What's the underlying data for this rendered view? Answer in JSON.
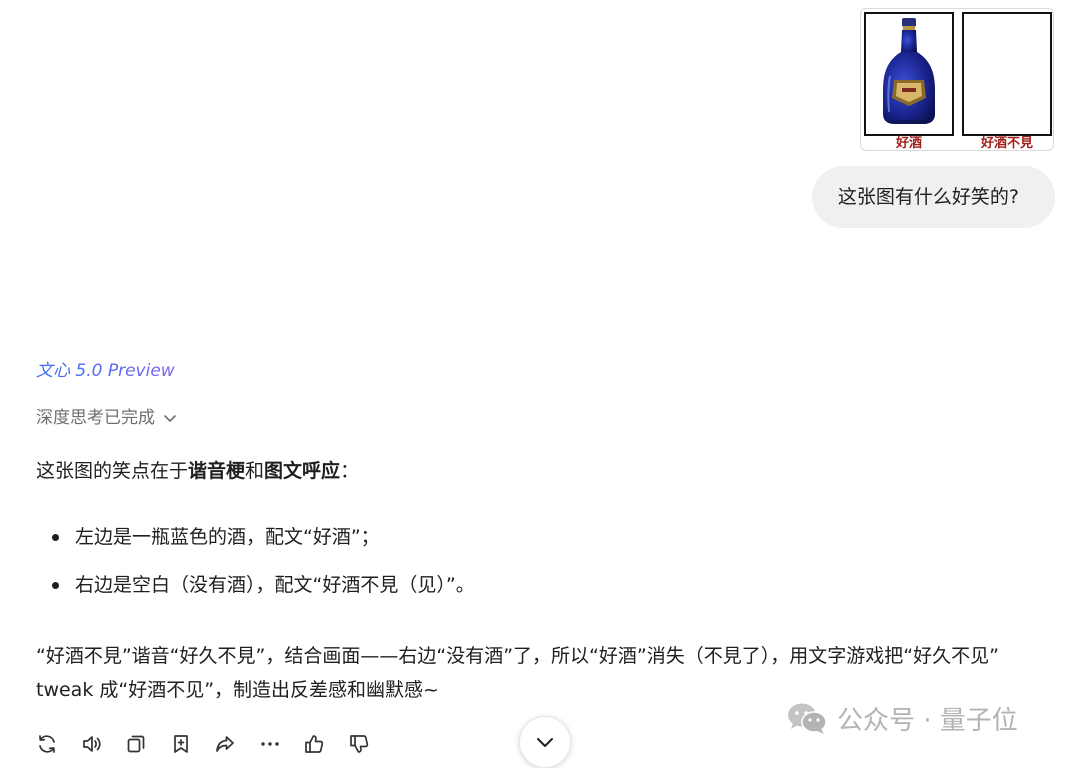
{
  "user_message": {
    "image": {
      "left_caption": "好酒",
      "right_caption": "好酒不見"
    },
    "text": "这张图有什么好笑的?"
  },
  "assistant": {
    "model_name": "文心 5.0 Preview",
    "thinking_status": "深度思考已完成",
    "intro": {
      "prefix": "这张图的笑点在于",
      "bold1": "谐音梗",
      "joiner": "和",
      "bold2": "图文呼应",
      "suffix": "："
    },
    "bullets": [
      "左边是一瓶蓝色的酒，配文“好酒”；",
      "右边是空白（没有酒），配文“好酒不見（见）”。"
    ],
    "paragraph": "“好酒不見”谐音“好久不見”，结合画面——右边“没有酒”了，所以“好酒”消失（不見了），用文字游戏把“好久不见” tweak 成“好酒不见”，制造出反差感和幽默感~"
  },
  "toolbar": {
    "icons": [
      "regenerate-icon",
      "speaker-icon",
      "copy-icon",
      "bookmark-add-icon",
      "share-icon",
      "more-icon",
      "thumbs-up-icon",
      "thumbs-down-icon"
    ]
  },
  "watermark": {
    "text": "公众号 · 量子位"
  },
  "colors": {
    "model_name_start": "#3a6cf0",
    "model_name_end": "#7b63f2",
    "caption_red": "#a0201c",
    "bubble_bg": "#f0f0f0",
    "muted_text": "#6f6f6f"
  }
}
